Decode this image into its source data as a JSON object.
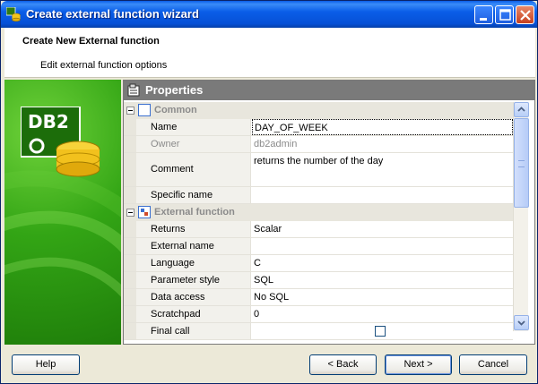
{
  "window": {
    "title": "Create external function wizard",
    "colors": {
      "titlebar": "#0a5ee8",
      "banner": "#33a515",
      "panel_header": "#7a7a7a"
    }
  },
  "header": {
    "title": "Create New External function",
    "subtitle": "Edit external function options"
  },
  "banner": {
    "logo_text": "DB2"
  },
  "properties": {
    "title": "Properties",
    "categories": [
      {
        "label": "Common",
        "rows": [
          {
            "name": "Name",
            "value": "DAY_OF_WEEK"
          },
          {
            "name": "Owner",
            "value": "db2admin"
          },
          {
            "name": "Comment",
            "value": "returns the number of the day"
          },
          {
            "name": "Specific name",
            "value": ""
          }
        ]
      },
      {
        "label": "External function",
        "rows": [
          {
            "name": "Returns",
            "value": "Scalar"
          },
          {
            "name": "External name",
            "value": ""
          },
          {
            "name": "Language",
            "value": "C"
          },
          {
            "name": "Parameter style",
            "value": "SQL"
          },
          {
            "name": "Data access",
            "value": "No SQL"
          },
          {
            "name": "Scratchpad",
            "value": "0"
          },
          {
            "name": "Final call",
            "value": ""
          }
        ]
      }
    ]
  },
  "buttons": {
    "help": "Help",
    "back": "< Back",
    "next": "Next >",
    "cancel": "Cancel"
  }
}
